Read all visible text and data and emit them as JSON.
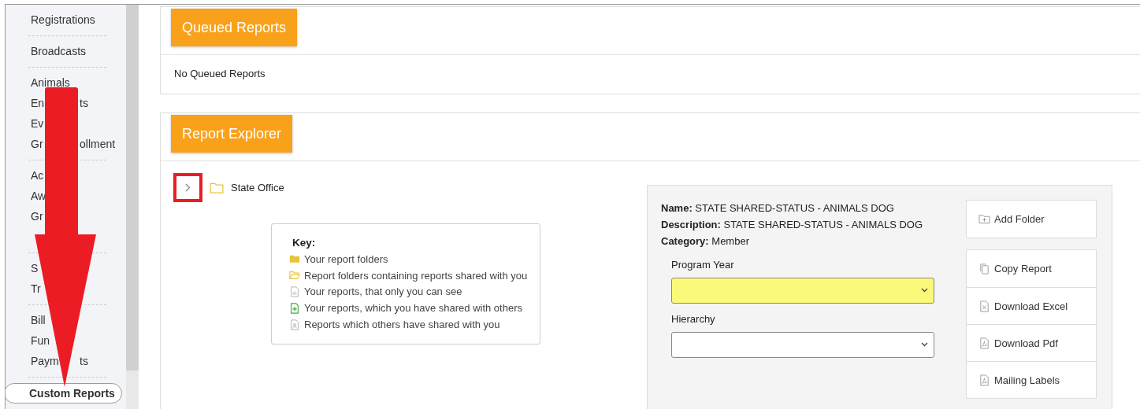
{
  "sidebar": {
    "groups": [
      {
        "items": [
          {
            "text": "Registrations",
            "selected": false
          }
        ]
      },
      {
        "items": [
          {
            "text": "Broadcasts",
            "selected": false
          }
        ]
      },
      {
        "items": [
          {
            "text": "Animals",
            "selected": false
          },
          {
            "text": "En",
            "tail": "ts",
            "selected": false
          },
          {
            "text": "Ev",
            "selected": false
          },
          {
            "text": "Gr",
            "tail": "ollment",
            "selected": false
          }
        ]
      },
      {
        "items": [
          {
            "text": "Ac",
            "selected": false
          },
          {
            "text": "Aw",
            "selected": false
          },
          {
            "text": "Gr",
            "selected": false
          }
        ]
      },
      {
        "items": [
          {
            "text": "S",
            "selected": false
          },
          {
            "text": "Tr",
            "selected": false
          }
        ]
      },
      {
        "items": [
          {
            "text": "Bill",
            "selected": false
          },
          {
            "text": "Fun",
            "selected": false
          },
          {
            "text": "Paym",
            "tail": "ts",
            "selected": false
          }
        ]
      },
      {
        "items": [
          {
            "text": "Custom Reports",
            "selected": true
          }
        ]
      }
    ]
  },
  "queued": {
    "title": "Queued Reports",
    "message": "No Queued Reports"
  },
  "explorer": {
    "title": "Report Explorer",
    "tree": [
      {
        "label": "State Office",
        "expanded": false,
        "annotated": true
      }
    ],
    "key": {
      "title": "Key:",
      "items": [
        {
          "kind": "folder",
          "text": "Your report folders"
        },
        {
          "kind": "folder-open",
          "text": "Report folders containing reports shared with you"
        },
        {
          "kind": "report",
          "text": "Your reports, that only you can see"
        },
        {
          "kind": "report-shared",
          "text": "Your reports, which you have shared with others"
        },
        {
          "kind": "report-received",
          "text": "Reports which others have shared with you"
        }
      ]
    },
    "details": {
      "fields": [
        {
          "label": "Name:",
          "value": "STATE SHARED-STATUS - ANIMALS DOG"
        },
        {
          "label": "Description:",
          "value": "STATE SHARED-STATUS - ANIMALS DOG"
        },
        {
          "label": "Category:",
          "value": "Member"
        }
      ],
      "selects": [
        {
          "label": "Program Year",
          "required": true
        },
        {
          "label": "Hierarchy",
          "required": false
        }
      ],
      "action_groups": [
        [
          {
            "kind": "add-folder",
            "label": "Add Folder"
          }
        ],
        [
          {
            "kind": "copy",
            "label": "Copy Report"
          },
          {
            "kind": "excel",
            "label": "Download Excel"
          },
          {
            "kind": "pdf",
            "label": "Download Pdf"
          },
          {
            "kind": "labels",
            "label": "Mailing Labels"
          }
        ]
      ]
    }
  }
}
